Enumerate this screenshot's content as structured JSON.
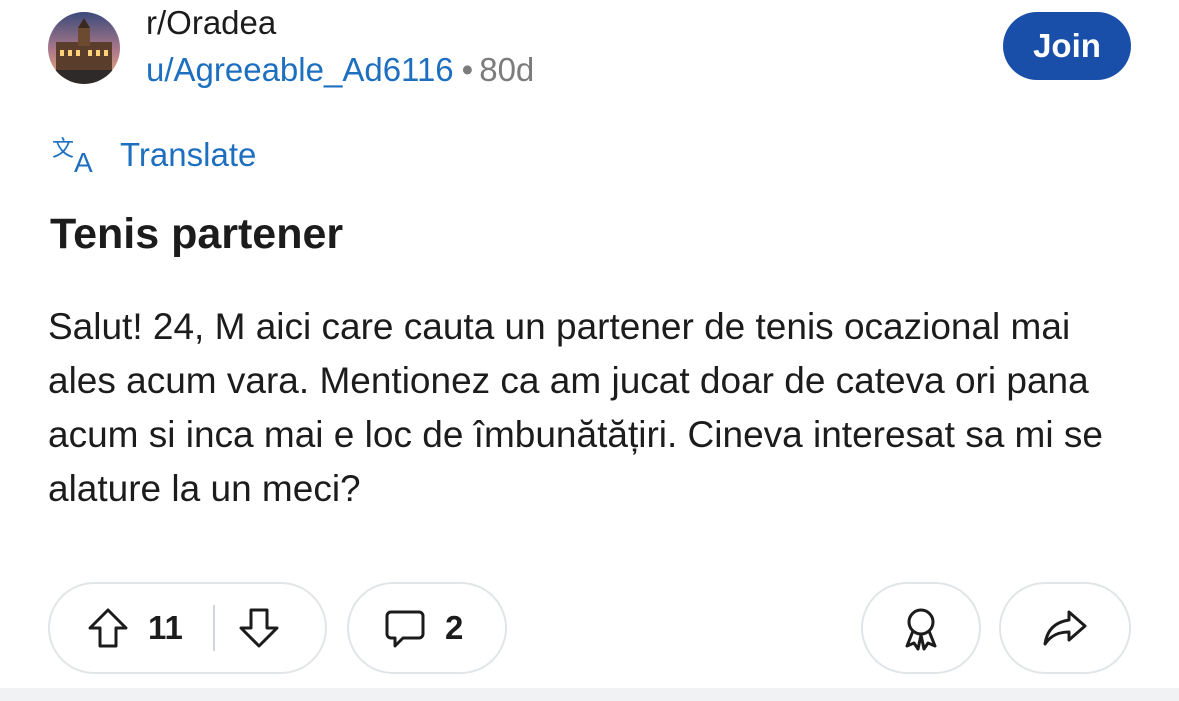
{
  "header": {
    "subreddit": "r/Oradea",
    "username": "u/Agreeable_Ad6116",
    "separator": "•",
    "age": "80d",
    "join_label": "Join"
  },
  "translate": {
    "label": "Translate",
    "icon": "translate-icon"
  },
  "post": {
    "title": "Tenis partener",
    "body": "Salut! 24, M aici care cauta un partener de tenis ocazional mai ales acum vara. Mentionez ca am jucat doar de cateva ori pana acum si inca mai e loc de îmbunătățiri. Cineva interesat sa mi se alature la un meci?"
  },
  "actions": {
    "upvotes": "11",
    "comments": "2",
    "icons": [
      "upvote-icon",
      "downvote-icon",
      "comment-icon",
      "award-icon",
      "share-icon"
    ]
  },
  "colors": {
    "link": "#1e6fc0",
    "join_bg": "#1a4fa9",
    "border": "#e2e5e8",
    "muted": "#7c7c7c"
  }
}
